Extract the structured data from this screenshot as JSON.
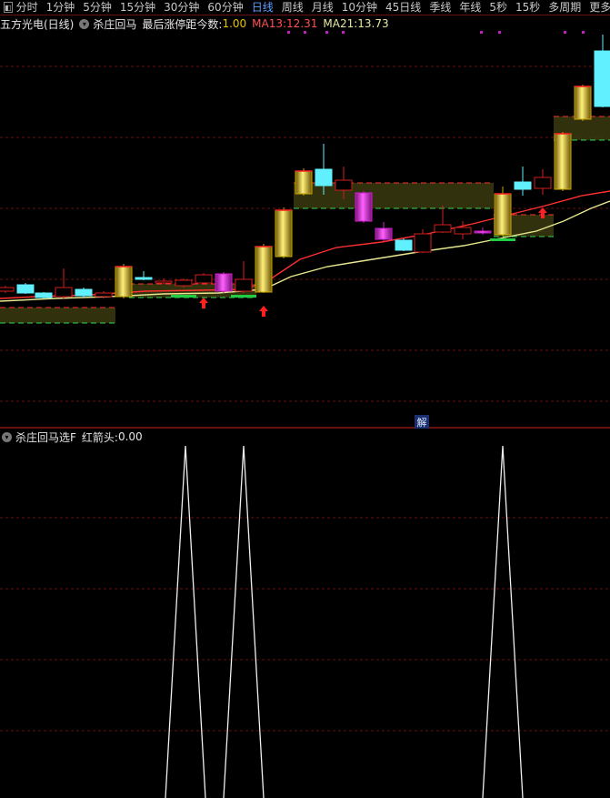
{
  "tabs": [
    "分时",
    "1分钟",
    "5分钟",
    "15分钟",
    "30分钟",
    "60分钟",
    "日线",
    "周线",
    "月线",
    "10分钟",
    "45日线",
    "季线",
    "年线",
    "5秒",
    "15秒",
    "多周期",
    "更多"
  ],
  "active_tab": "日线",
  "main_header": {
    "stock": "五方光电(日线)",
    "indicator": "杀庄回马",
    "last_limit_label": "最后涨停距今数:",
    "last_limit_value": "1.00",
    "ma13_label": "MA13:",
    "ma13_value": "12.31",
    "ma21_label": "MA21:",
    "ma21_value": "13.73"
  },
  "jie_button": "解",
  "sub_header": {
    "indicator": "杀庄回马选F",
    "red_arrow_label": "红箭头:",
    "red_arrow_value": "0.00"
  },
  "colors": {
    "up": "#d02020",
    "down_cyan": "#60f0ff",
    "magenta": "#d020d0",
    "gold": "#e8c800",
    "ma13": "#ff3030",
    "ma21": "#e8e890",
    "green_bar": "#22cc44",
    "grid": "#6a1010",
    "sep": "#cc2020"
  },
  "icons": [
    "sidebar-toggle-icon",
    "dropdown-icon",
    "red-up-arrow-icon"
  ],
  "red_arrow_days": [
    10,
    13,
    27
  ]
}
